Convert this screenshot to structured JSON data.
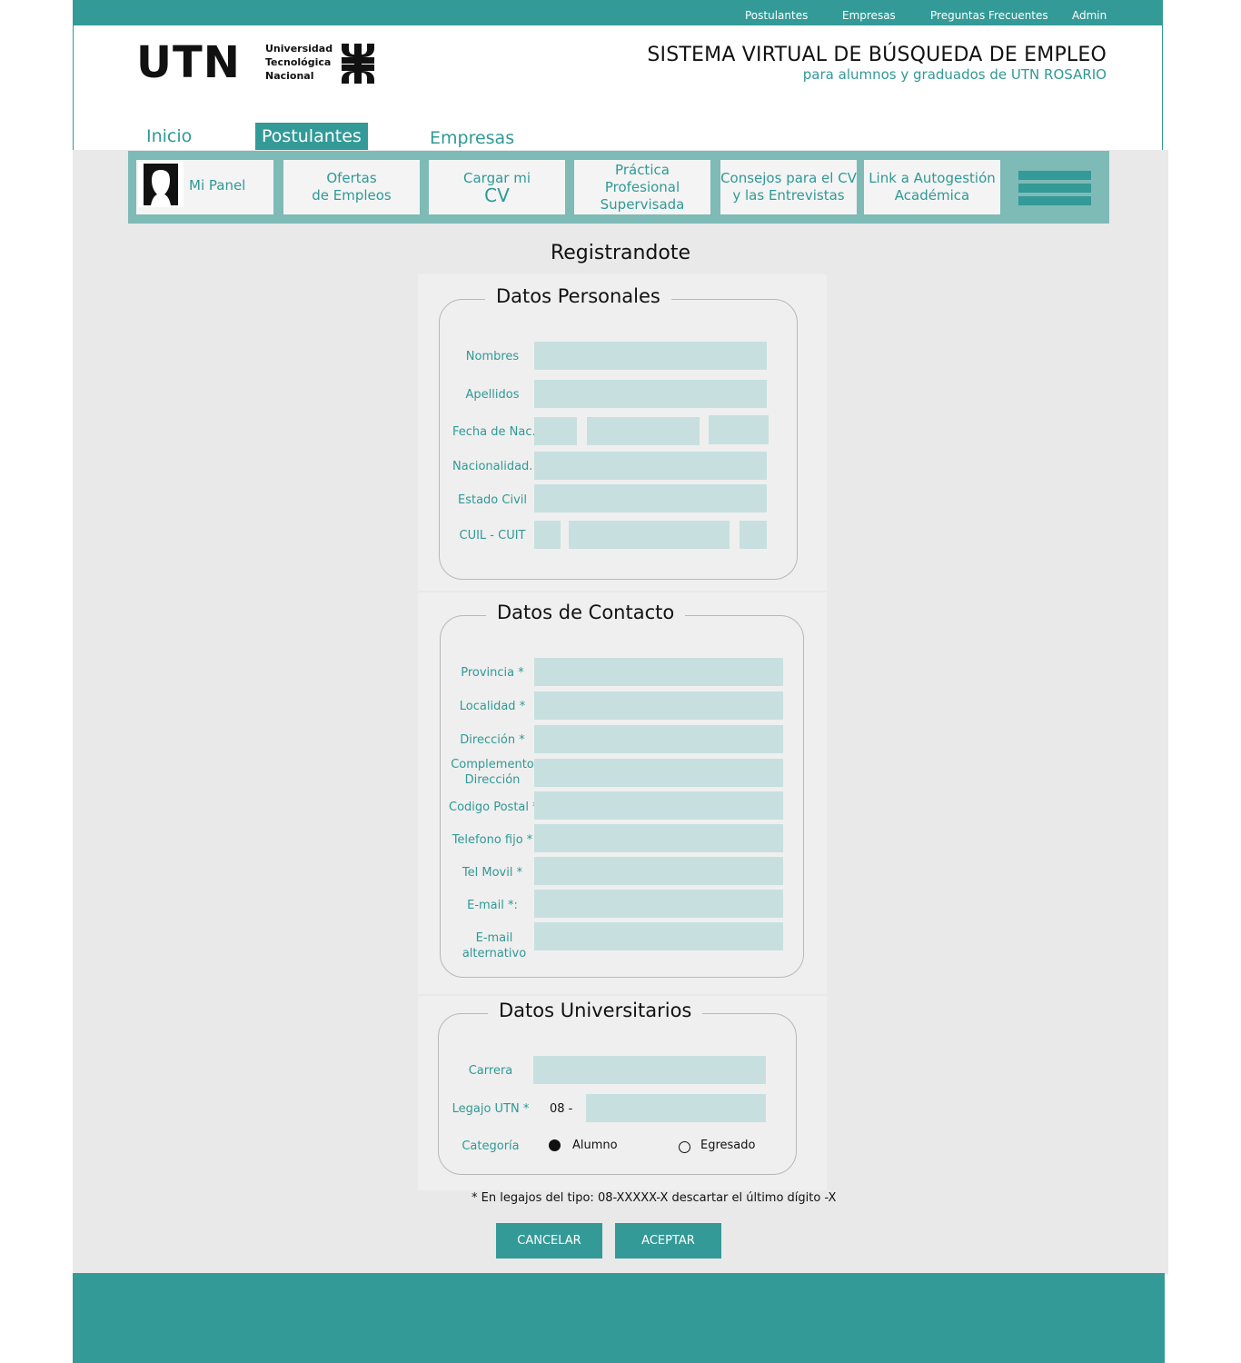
{
  "topnav": {
    "postulantes": "Postulantes",
    "empresas": "Empresas",
    "faq": "Preguntas Frecuentes",
    "admin": "Admin"
  },
  "logo": {
    "acronym": "UTN",
    "line1": "Universidad",
    "line2": "Tecnológica",
    "line3": "Nacional"
  },
  "header": {
    "title": "SISTEMA VIRTUAL DE BÚSQUEDA DE EMPLEO",
    "subtitle": "para alumnos y graduados de UTN ROSARIO"
  },
  "maintabs": {
    "inicio": "Inicio",
    "postulantes": "Postulantes",
    "empresas": "Empresas"
  },
  "subnav": {
    "mi_panel": "Mi Panel",
    "ofertas_1": "Ofertas",
    "ofertas_2": "de Empleos",
    "cargar_1": "Cargar mi",
    "cargar_2": "CV",
    "practica_1": "Práctica",
    "practica_2": "Profesional",
    "practica_3": "Supervisada",
    "consejos_1": "Consejos para el CV",
    "consejos_2": "y las Entrevistas",
    "link_1": "Link a Autogestión",
    "link_2": "Académica"
  },
  "page_title": "Registrandote",
  "personal": {
    "legend": "Datos Personales",
    "nombres": "Nombres",
    "apellidos": "Apellidos",
    "fecha": "Fecha de Nac.",
    "nacionalidad": "Nacionalidad.",
    "estado_civil": "Estado Civil",
    "cuil": "CUIL  - CUIT"
  },
  "contacto": {
    "legend": "Datos de Contacto",
    "provincia": "Provincia *",
    "localidad": "Localidad *",
    "direccion": "Dirección *",
    "complemento_1": "Complemento",
    "complemento_2": "Dirección",
    "cp": "Codigo Postal *",
    "telefono": "Telefono fijo *",
    "movil": "Tel Movil *",
    "email": "E-mail *:",
    "email_alt_1": "E-mail",
    "email_alt_2": "alternativo"
  },
  "universitarios": {
    "legend": "Datos Universitarios",
    "carrera": "Carrera",
    "legajo": "Legajo UTN *",
    "legajo_prefix": "08 -",
    "categoria": "Categoría",
    "alumno": "Alumno",
    "egresado": "Egresado",
    "selected": "Alumno"
  },
  "note": "* En legajos del tipo: 08-XXXXX-X descartar el último dígito -X",
  "buttons": {
    "cancel": "CANCELAR",
    "accept": "ACEPTAR"
  },
  "colors": {
    "teal": "#339a97",
    "teal_text": "#2f9995",
    "teal_light": "#7ebab6",
    "input": "#c8dfdf",
    "background": "#e9e9e9"
  },
  "icons": {
    "avatar": "user-silhouette-icon",
    "menu": "hamburger-icon",
    "emblem": "utn-emblem-icon"
  }
}
